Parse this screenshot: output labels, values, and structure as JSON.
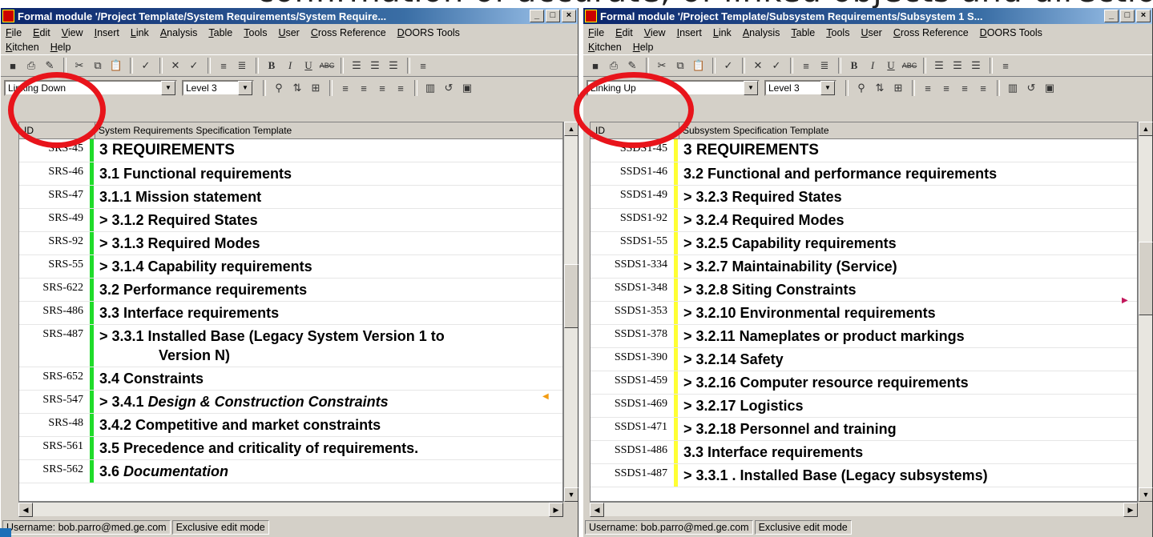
{
  "left_window": {
    "title": "Formal module '/Project Template/System Requirements/System Require...",
    "menus": [
      "File",
      "Edit",
      "View",
      "Insert",
      "Link",
      "Analysis",
      "Table",
      "Tools",
      "User",
      "Cross Reference",
      "DOORS Tools",
      "Kitchen",
      "Help"
    ],
    "view_combo": "Linking Down",
    "level_combo": "Level 3",
    "column_id_header": "ID",
    "column_title_header": "System Requirements Specification Template",
    "rows": [
      {
        "id": "SRS-45",
        "text": "3 REQUIREMENTS",
        "bar": "#1fdc2a"
      },
      {
        "id": "SRS-46",
        "text": "3.1 Functional requirements",
        "bar": "#1fdc2a"
      },
      {
        "id": "SRS-47",
        "text": "3.1.1 Mission statement",
        "bar": "#1fdc2a"
      },
      {
        "id": "SRS-49",
        "text": "> 3.1.2 Required States",
        "bar": "#1fdc2a"
      },
      {
        "id": "SRS-92",
        "text": "> 3.1.3 Required Modes",
        "bar": "#1fdc2a"
      },
      {
        "id": "SRS-55",
        "text": "> 3.1.4 Capability requirements",
        "bar": "#1fdc2a"
      },
      {
        "id": "SRS-622",
        "text": "3.2 Performance requirements",
        "bar": "#1fdc2a"
      },
      {
        "id": "SRS-486",
        "text": "3.3 Interface requirements",
        "bar": "#1fdc2a"
      },
      {
        "id": "SRS-487",
        "text": "> 3.3.1 Installed Base (Legacy System Version 1  to",
        "text2": "Version N)",
        "bar": "#1fdc2a"
      },
      {
        "id": "SRS-652",
        "text": "3.4 Constraints",
        "bar": "#1fdc2a"
      },
      {
        "id": "SRS-547",
        "text": "> 3.4.1 ",
        "italic": "Design & Construction Constraints",
        "bar": "#1fdc2a"
      },
      {
        "id": "SRS-48",
        "text": "3.4.2 Competitive and market constraints",
        "bar": "#1fdc2a"
      },
      {
        "id": "SRS-561",
        "text": "3.5 Precedence and criticality of requirements.",
        "bar": "#1fdc2a"
      },
      {
        "id": "SRS-562",
        "text": "3.6 ",
        "italic": "Documentation",
        "bar": "#1fdc2a"
      }
    ],
    "status": [
      "Username: bob.parro@med.ge.com",
      "Exclusive edit mode"
    ]
  },
  "right_window": {
    "title": "Formal module '/Project Template/Subsystem Requirements/Subsystem 1 S...",
    "menus": [
      "File",
      "Edit",
      "View",
      "Insert",
      "Link",
      "Analysis",
      "Table",
      "Tools",
      "User",
      "Cross Reference",
      "DOORS Tools",
      "Kitchen",
      "Help"
    ],
    "view_combo": "Linking Up",
    "level_combo": "Level 3",
    "column_id_header": "ID",
    "column_title_header": "Subsystem Specification Template",
    "rows": [
      {
        "id": "SSDS1-45",
        "text": "3 REQUIREMENTS",
        "bar": "#ffff33"
      },
      {
        "id": "SSDS1-46",
        "text": "3.2 Functional and performance requirements",
        "bar": "#ffff33"
      },
      {
        "id": "SSDS1-49",
        "text": "> 3.2.3 Required States",
        "bar": "#ffff33"
      },
      {
        "id": "SSDS1-92",
        "text": "> 3.2.4 Required Modes",
        "bar": "#ffff33"
      },
      {
        "id": "SSDS1-55",
        "text": "> 3.2.5 Capability requirements",
        "bar": "#ffff33"
      },
      {
        "id": "SSDS1-334",
        "text": "> 3.2.7 Maintainability (Service)",
        "bar": "#ffff33"
      },
      {
        "id": "SSDS1-348",
        "text": "> 3.2.8 Siting Constraints",
        "bar": "#ffff33"
      },
      {
        "id": "SSDS1-353",
        "text": "> 3.2.10 Environmental requirements",
        "bar": "#ffff33"
      },
      {
        "id": "SSDS1-378",
        "text": "> 3.2.11 Nameplates or product markings",
        "bar": "#ffff33"
      },
      {
        "id": "SSDS1-390",
        "text": "> 3.2.14 Safety",
        "bar": "#ffff33"
      },
      {
        "id": "SSDS1-459",
        "text": "> 3.2.16 Computer resource requirements",
        "bar": "#ffff33"
      },
      {
        "id": "SSDS1-469",
        "text": "> 3.2.17 Logistics",
        "bar": "#ffff33"
      },
      {
        "id": "SSDS1-471",
        "text": "> 3.2.18 Personnel and training",
        "bar": "#ffff33"
      },
      {
        "id": "SSDS1-486",
        "text": "3.3 Interface requirements",
        "bar": "#ffff33"
      },
      {
        "id": "SSDS1-487",
        "text": "> 3.3.1 . Installed Base (Legacy subsystems)",
        "bar": "#ffff33"
      }
    ],
    "status": [
      "Username: bob.parro@med.ge.com",
      "Exclusive edit mode"
    ]
  },
  "slide_header_fragment": "confirmation of accurate, of linked objects and direction",
  "colors": {
    "highlight_circle": "#e8141b",
    "titlebar": "#0a246a",
    "out_link_marker": "#f39c12",
    "in_link_marker": "#c2185b"
  }
}
